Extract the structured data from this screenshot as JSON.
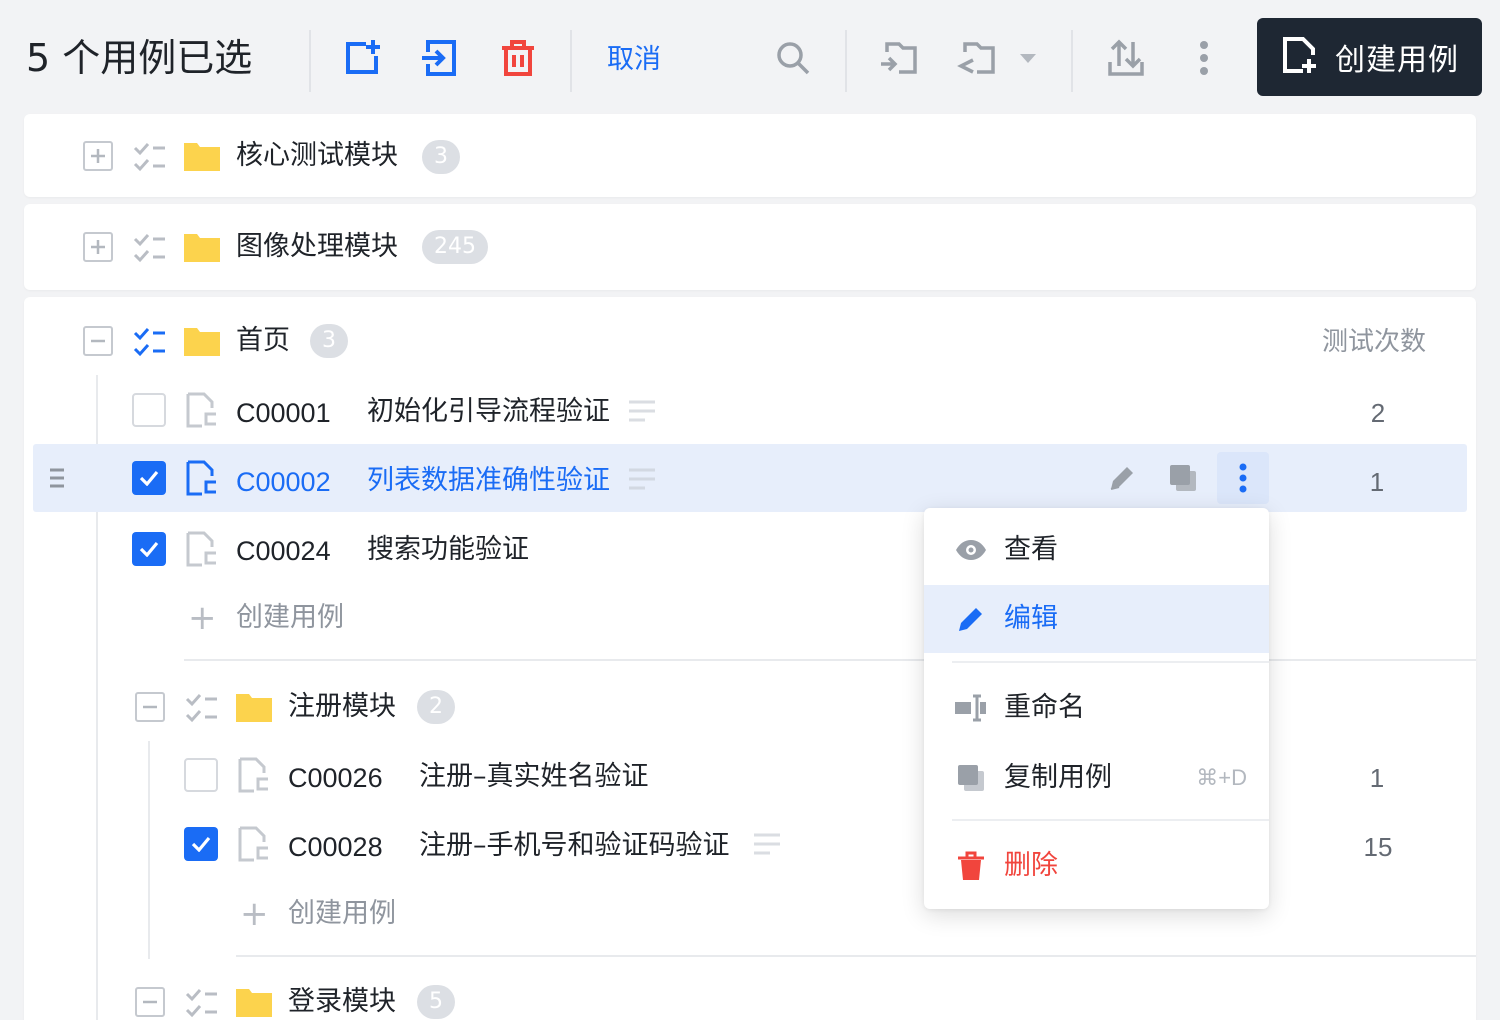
{
  "toolbar": {
    "selection_title": "5 个用例已选",
    "cancel_label": "取消",
    "create_label": "创建用例",
    "icons": [
      "add-folder-icon",
      "move-in-icon",
      "delete-icon",
      "search-icon",
      "move-out-icon",
      "move-out-dropdown-icon",
      "chevron-down-icon",
      "import-export-icon",
      "more-icon",
      "create-case-icon"
    ],
    "accent": "#1a6cf5",
    "danger": "#f1453d"
  },
  "tree": {
    "column_header": "测试次数",
    "folders": [
      {
        "name": "核心测试模块",
        "count": "3",
        "expanded": false
      },
      {
        "name": "图像处理模块",
        "count": "245",
        "expanded": false
      },
      {
        "name": "首页",
        "count": "3",
        "expanded": true,
        "cases": [
          {
            "id": "C00001",
            "title": "初始化引导流程验证",
            "runs": "2",
            "checked": false,
            "has_desc": true
          },
          {
            "id": "C00002",
            "title": "列表数据准确性验证",
            "runs": "1",
            "checked": true,
            "has_desc": true,
            "highlighted": true
          },
          {
            "id": "C00024",
            "title": "搜索功能验证",
            "runs": "",
            "checked": true,
            "has_desc": false
          }
        ],
        "add_case_label": "创建用例",
        "subfolders": [
          {
            "name": "注册模块",
            "count": "2",
            "expanded": true,
            "cases": [
              {
                "id": "C00026",
                "title": "注册–真实姓名验证",
                "runs": "1",
                "checked": false,
                "has_desc": false
              },
              {
                "id": "C00028",
                "title": "注册–手机号和验证码验证",
                "runs": "15",
                "checked": true,
                "has_desc": true
              }
            ],
            "add_case_label": "创建用例"
          },
          {
            "name": "登录模块",
            "count": "5",
            "expanded": true
          }
        ]
      }
    ]
  },
  "context_menu": {
    "items": [
      {
        "label": "查看",
        "icon": "eye-icon"
      },
      {
        "label": "编辑",
        "icon": "pencil-icon",
        "active": true
      },
      {
        "label": "重命名",
        "icon": "rename-icon"
      },
      {
        "label": "复制用例",
        "icon": "copy-icon",
        "shortcut": "⌘+D"
      },
      {
        "label": "删除",
        "icon": "trash-icon",
        "danger": true
      }
    ]
  }
}
